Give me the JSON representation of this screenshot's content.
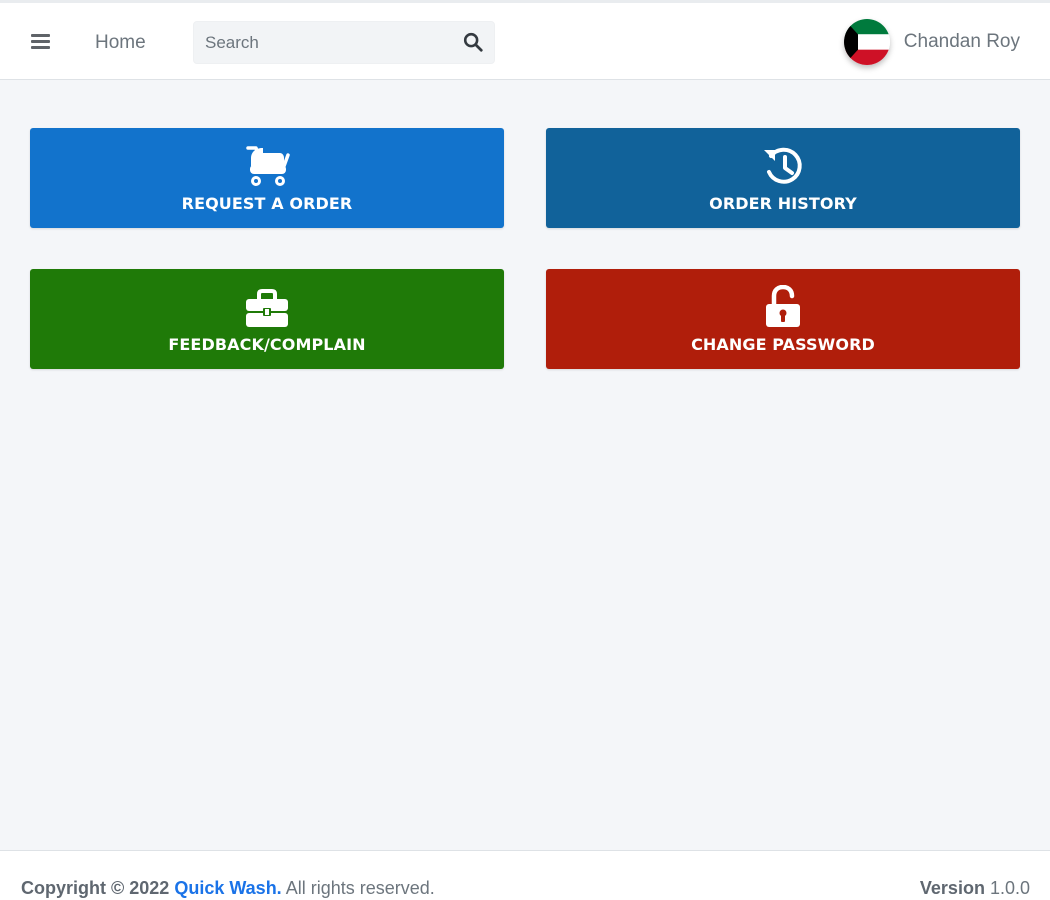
{
  "header": {
    "menu_icon": "hamburger-icon",
    "home_label": "Home",
    "search": {
      "placeholder": "Search",
      "value": "",
      "icon": "search-icon"
    },
    "user": {
      "name": "Chandan Roy",
      "avatar_icon": "kuwait-flag-icon"
    }
  },
  "tiles": [
    {
      "label": "REQUEST A ORDER",
      "icon": "baby-carriage-icon",
      "color": "#1273cc"
    },
    {
      "label": "ORDER HISTORY",
      "icon": "history-icon",
      "color": "#11629a"
    },
    {
      "label": "FEEDBACK/COMPLAIN",
      "icon": "toolbox-icon",
      "color": "#1f7a08"
    },
    {
      "label": "CHANGE PASSWORD",
      "icon": "unlock-icon",
      "color": "#b01e0b"
    }
  ],
  "footer": {
    "copyright_prefix": "Copyright © 2022",
    "brand": "Quick Wash.",
    "rights": "All rights reserved.",
    "version_label": "Version",
    "version_value": "1.0.0"
  },
  "colors": {
    "background": "#f4f6f9",
    "link": "#1a73e8",
    "request": "#1273cc",
    "history": "#11629a",
    "feedback": "#1f7a08",
    "password": "#b01e0b"
  }
}
